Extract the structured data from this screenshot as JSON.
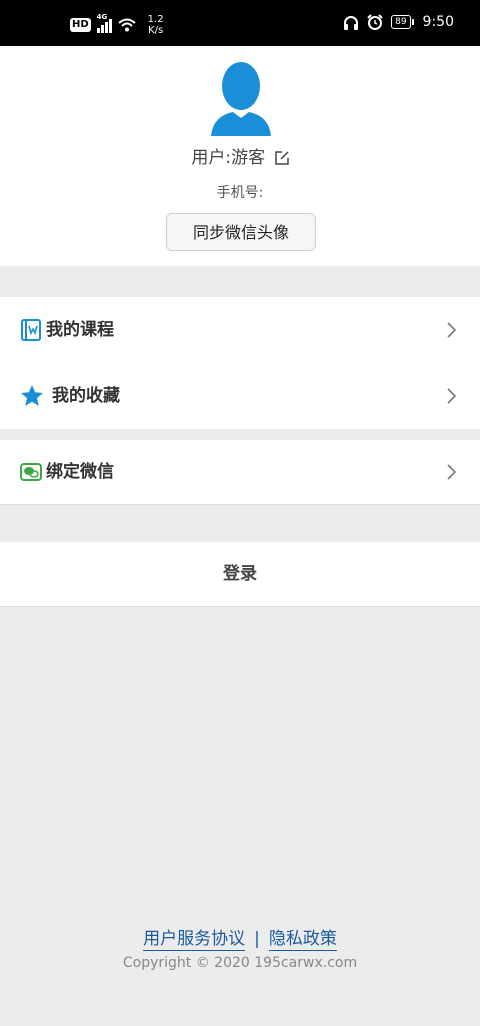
{
  "status_bar": {
    "hd": "HD",
    "network": "4G",
    "speed_top": "1.2",
    "speed_bottom": "K/s",
    "battery": "89",
    "time": "9:50"
  },
  "profile": {
    "user_label": "用户:游客",
    "phone_label": "手机号:",
    "sync_button": "同步微信头像"
  },
  "menu": {
    "courses": "我的课程",
    "favorites": "我的收藏",
    "bind_wechat": "绑定微信"
  },
  "login": "登录",
  "footer": {
    "terms": "用户服务协议",
    "separator": "|",
    "privacy": "隐私政策",
    "copyright": "Copyright © 2020 195carwx.com"
  },
  "colors": {
    "accent_blue": "#1a8fd8",
    "wechat_green": "#3aa845",
    "link_blue": "#1a5a9e",
    "background": "#ececec"
  },
  "icons": {
    "courses": "book-icon",
    "favorites": "star-icon",
    "bind_wechat": "wechat-icon",
    "edit": "edit-icon",
    "chevron": "chevron-right-icon"
  }
}
